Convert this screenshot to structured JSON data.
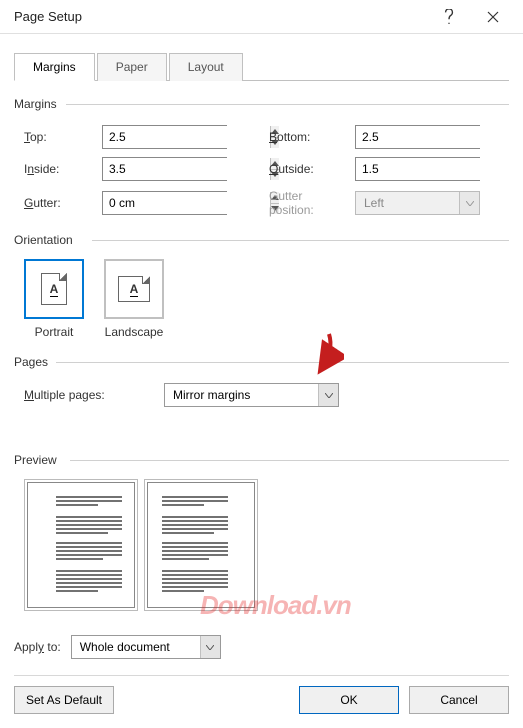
{
  "titlebar": {
    "title": "Page Setup"
  },
  "tabs": {
    "margins": "Margins",
    "paper": "Paper",
    "layout": "Layout"
  },
  "margins": {
    "section": "Margins",
    "top_label": "Top:",
    "top_val": "2.5",
    "bottom_label": "Bottom:",
    "bottom_val": "2.5",
    "inside_label": "Inside:",
    "inside_val": "3.5",
    "outside_label": "Outside:",
    "outside_val": "1.5",
    "gutter_label": "Gutter:",
    "gutter_val": "0 cm",
    "gutterpos_label": "Gutter position:",
    "gutterpos_val": "Left"
  },
  "orientation": {
    "section": "Orientation",
    "portrait": "Portrait",
    "landscape": "Landscape"
  },
  "pages": {
    "section": "Pages",
    "multi_label": "Multiple pages:",
    "multi_val": "Mirror margins"
  },
  "preview": {
    "section": "Preview"
  },
  "apply": {
    "label": "Apply to:",
    "val": "Whole document"
  },
  "footer": {
    "default": "Set As Default",
    "ok": "OK",
    "cancel": "Cancel"
  },
  "watermark": "Download.vn"
}
